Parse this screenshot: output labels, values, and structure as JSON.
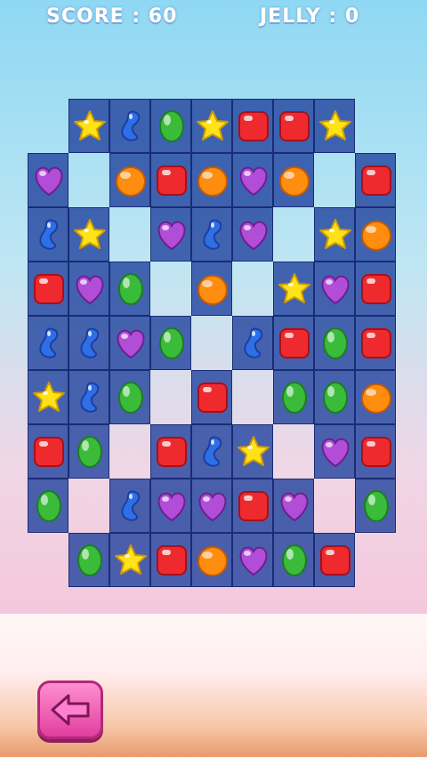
{
  "hud": {
    "score_text": "SCORE : 60",
    "jelly_text": "JELLY : 0"
  },
  "colors": {
    "red": "#ee2a2e",
    "blue": "#2f6fe6",
    "green": "#3bbb3a",
    "yellow": "#ffe318",
    "orange": "#ff8d10",
    "purple": "#b24dd8"
  },
  "board": {
    "cols": 9,
    "rows": 9,
    "grid": [
      [
        null,
        "star",
        "bean",
        "green",
        "star",
        "red",
        "red",
        "star",
        null
      ],
      [
        "heart",
        "-",
        "orange",
        "red",
        "orange",
        "heart",
        "orange",
        "-",
        "red"
      ],
      [
        "bean",
        "star",
        "-",
        "heart",
        "bean",
        "heart",
        "-",
        "star",
        "orange"
      ],
      [
        "red",
        "heart",
        "green",
        "-",
        "orange",
        "-",
        "star",
        "heart",
        "red"
      ],
      [
        "bean",
        "bean",
        "heart",
        "green",
        "-",
        "bean",
        "red",
        "green",
        "red"
      ],
      [
        "star",
        "bean",
        "green",
        "-",
        "red",
        "-",
        "green",
        "green",
        "orange"
      ],
      [
        "red",
        "green",
        "-",
        "red",
        "bean",
        "star",
        "-",
        "heart",
        "red"
      ],
      [
        "green",
        "-",
        "bean",
        "heart",
        "heart",
        "red",
        "heart",
        "-",
        "green"
      ],
      [
        null,
        "green",
        "star",
        "red",
        "orange",
        "heart",
        "green",
        "red",
        null
      ]
    ]
  },
  "back_button": {
    "icon": "arrow-left-icon"
  }
}
